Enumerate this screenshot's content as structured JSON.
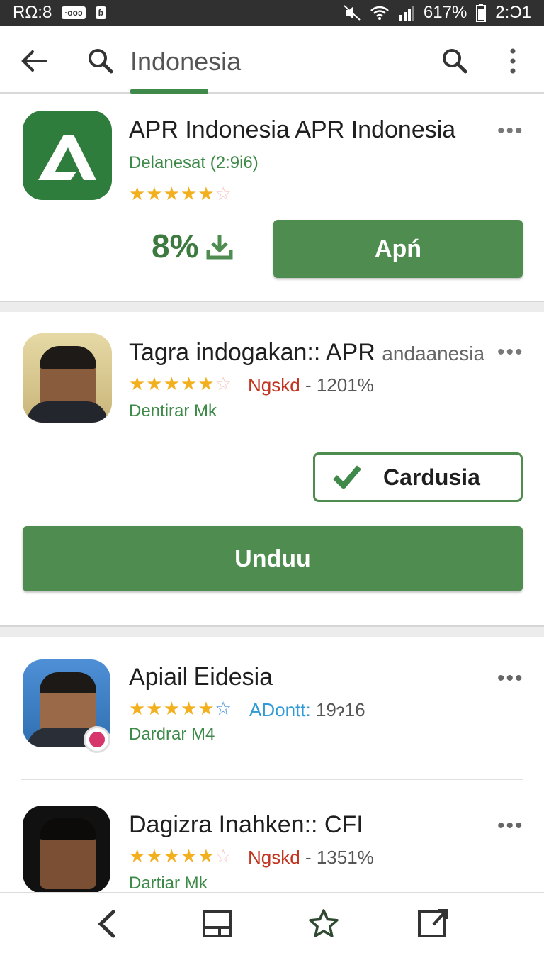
{
  "status": {
    "time_left": "RΩ:8",
    "badge1": "·ooɔ",
    "badge2": "ɓ",
    "battery": "617%",
    "time_right": "2:Ͻ1"
  },
  "search": {
    "query": "Indonesia"
  },
  "colors": {
    "accent": "#4e8d4f",
    "star": "#f2b01e",
    "red_meta": "#c2341f",
    "blue_meta": "#2f9ad6"
  },
  "app1": {
    "title": "APR Indonesia APR Indonesia",
    "subtitle": "Delanesat (2:9i6)",
    "rating": 4,
    "progress": "8%",
    "action": "Apń",
    "icon": "apr-logo-icon"
  },
  "app2": {
    "title": "Tagra indogakan:: APR",
    "title_suffix": "andaanesia",
    "meta_red": "Ngskd",
    "meta_gray": "- 1201%",
    "developer": "Dentirar Mk",
    "installed_label": "Cardusia",
    "download_label": "Unduu",
    "rating": 5
  },
  "app3": {
    "title": "Apiail Ꭼidesia",
    "meta_blue": "ADontt:",
    "meta_gray": "19ɂ16",
    "developer": "Dardrar M4",
    "rating": 5
  },
  "app4": {
    "title": "Dagizra Inahken:: CFI",
    "meta_red": "Ngskd",
    "meta_gray": "- 1351%",
    "developer": "Dartiar Mk",
    "rating": 5
  },
  "nav": [
    "back-nav",
    "recents-nav",
    "favorite-nav",
    "open-nav"
  ]
}
